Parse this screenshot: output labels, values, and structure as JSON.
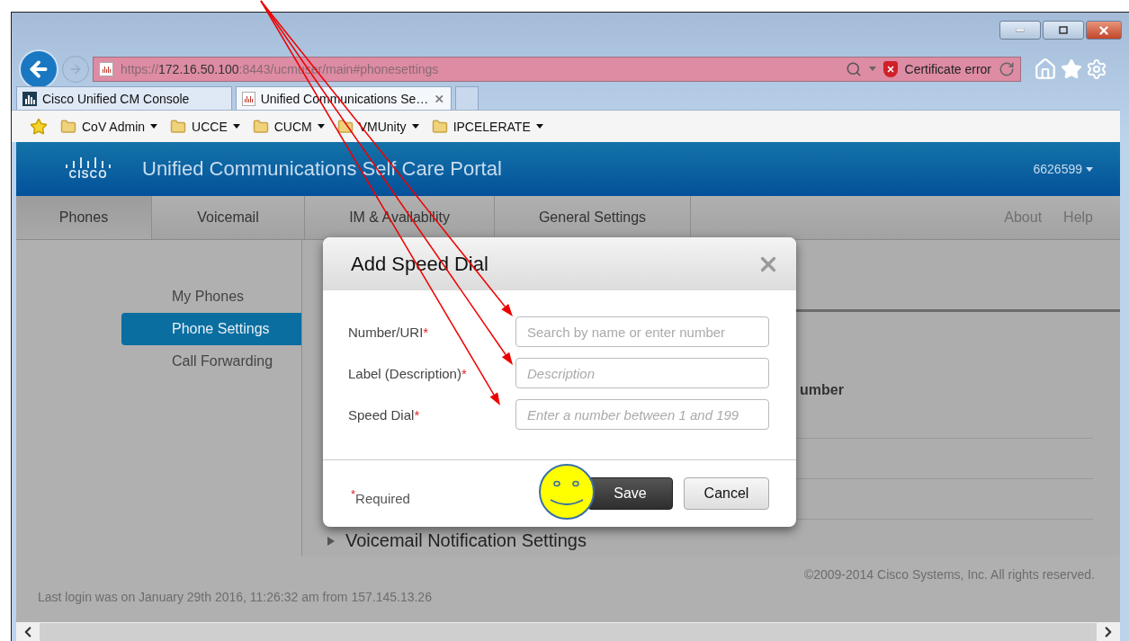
{
  "browser": {
    "address": "https://**172.16.50.100**:8443/ucmuser/main#phonesettings",
    "certificate_status": "Certificate error",
    "tabs": [
      {
        "title": "Cisco Unified CM Console",
        "selected": false
      },
      {
        "title": "Unified Communications Se…",
        "selected": true
      }
    ],
    "favorites": [
      "CoV Admin",
      "UCCE",
      "CUCM",
      "VMUnity",
      "IPCELERATE"
    ]
  },
  "portal": {
    "logo": "CISCO",
    "title": "Unified Communications Self Care Portal",
    "user": "6626599",
    "nav": [
      {
        "label": "Phones",
        "selected": true
      },
      {
        "label": "Voicemail",
        "selected": false
      },
      {
        "label": "IM & Availability",
        "selected": false
      },
      {
        "label": "General Settings",
        "selected": false
      }
    ],
    "links": [
      "About",
      "Help"
    ],
    "sidebar": [
      {
        "label": "My Phones",
        "selected": false
      },
      {
        "label": "Phone Settings",
        "selected": true
      },
      {
        "label": "Call Forwarding",
        "selected": false
      }
    ],
    "background_fragment": "umber",
    "section": "Voicemail Notification Settings",
    "last_login": "Last login was on January 29th 2016, 11:26:32 am from 157.145.13.26",
    "copyright": "©2009-2014 Cisco Systems, Inc. All rights reserved."
  },
  "dialog": {
    "title": "Add Speed Dial",
    "required_mark": "*",
    "fields": [
      {
        "label": "Number/URI",
        "required": true,
        "placeholder": "Search by name or enter number",
        "italic": false
      },
      {
        "label": "Label (Description)",
        "required": true,
        "placeholder": "Description",
        "italic": true
      },
      {
        "label": "Speed Dial",
        "required": true,
        "placeholder": "Enter a number between 1 and 199",
        "italic": true
      }
    ],
    "required_note": "Required",
    "buttons": [
      {
        "label": "Save",
        "kind": "primary"
      },
      {
        "label": "Cancel",
        "kind": "secondary"
      }
    ]
  }
}
